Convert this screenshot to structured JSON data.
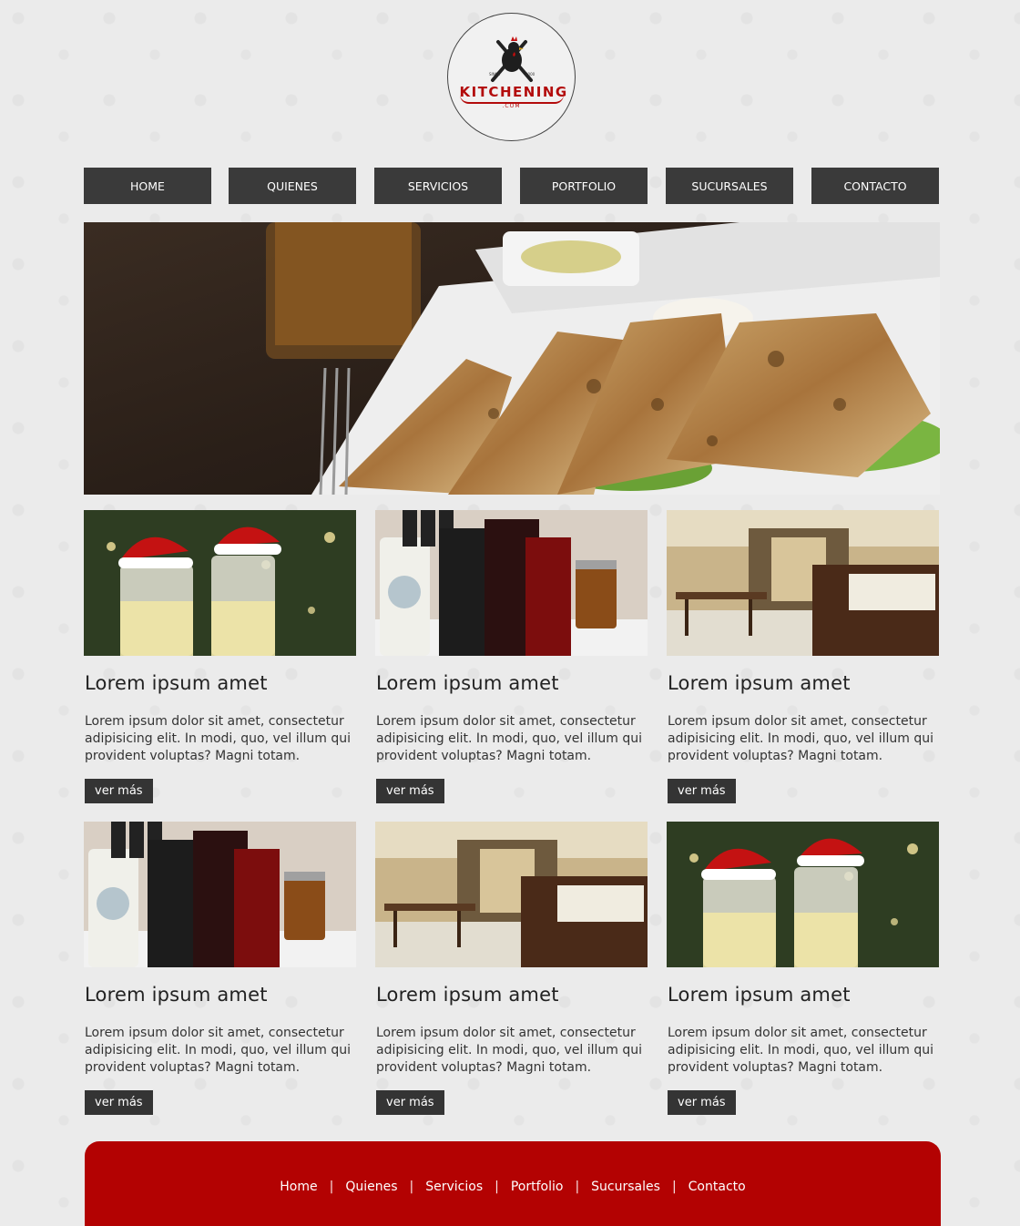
{
  "logo": {
    "name": "KITCHENING",
    "sub": ".COM",
    "since": "SINCE",
    "year": "2000"
  },
  "nav": [
    {
      "label": "HOME"
    },
    {
      "label": "QUIENES"
    },
    {
      "label": "SERVICIOS"
    },
    {
      "label": "PORTFOLIO"
    },
    {
      "label": "SUCURSALES"
    },
    {
      "label": "CONTACTO"
    }
  ],
  "cards": [
    {
      "title": "Lorem ipsum amet",
      "text": "Lorem ipsum dolor sit amet, consectetur adipisicing elit. In modi, quo, vel illum qui provident voluptas? Magni totam.",
      "button": "ver más",
      "image": "champagne-glasses"
    },
    {
      "title": "Lorem ipsum amet",
      "text": "Lorem ipsum dolor sit amet, consectetur adipisicing elit. In modi, quo, vel illum qui provident voluptas? Magni totam.",
      "button": "ver más",
      "image": "gourmet-products"
    },
    {
      "title": "Lorem ipsum amet",
      "text": "Lorem ipsum dolor sit amet, consectetur adipisicing elit. In modi, quo, vel illum qui provident voluptas? Magni totam.",
      "button": "ver más",
      "image": "restaurant-interior"
    },
    {
      "title": "Lorem ipsum amet",
      "text": "Lorem ipsum dolor sit amet, consectetur adipisicing elit. In modi, quo, vel illum qui provident voluptas? Magni totam.",
      "button": "ver más",
      "image": "gourmet-products"
    },
    {
      "title": "Lorem ipsum amet",
      "text": "Lorem ipsum dolor sit amet, consectetur adipisicing elit. In modi, quo, vel illum qui provident voluptas? Magni totam.",
      "button": "ver más",
      "image": "restaurant-interior"
    },
    {
      "title": "Lorem ipsum amet",
      "text": "Lorem ipsum dolor sit amet, consectetur adipisicing elit. In modi, quo, vel illum qui provident voluptas? Magni totam.",
      "button": "ver más",
      "image": "champagne-glasses"
    }
  ],
  "footer": {
    "links": [
      {
        "label": "Home"
      },
      {
        "label": "Quienes"
      },
      {
        "label": "Servicios"
      },
      {
        "label": "Portfolio"
      },
      {
        "label": "Sucursales"
      },
      {
        "label": "Contacto"
      }
    ],
    "separator": "|"
  },
  "colors": {
    "nav_bg": "#3a3a3a",
    "footer_bg": "#b30202",
    "brand_red": "#b30c0c",
    "page_bg": "#ebebeb"
  }
}
